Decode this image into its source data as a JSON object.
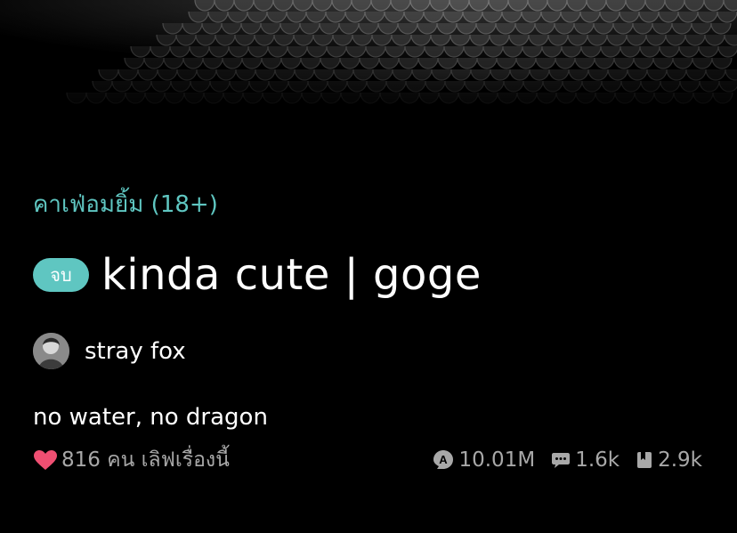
{
  "cover": {
    "image": "dark-scales-cover-image"
  },
  "story": {
    "category": "คาเฟ่อมยิ้ม (18+)",
    "status_badge": "จบ",
    "title": "kinda cute | goge",
    "author": {
      "name": "stray fox",
      "avatar": "avatar-image"
    },
    "description": "no water, no dragon",
    "likes_text": "816 คน เลิฟเรื่องนี้",
    "stats": {
      "views": "10.01M",
      "comments": "1.6k",
      "bookmarks": "2.9k"
    }
  },
  "colors": {
    "accent": "#5fc6c1",
    "heart": "#ef4f72",
    "muted_text": "#a8a8a8",
    "background": "#000000"
  },
  "icons": [
    "heart-icon",
    "views-icon",
    "comment-icon",
    "bookmark-icon"
  ]
}
